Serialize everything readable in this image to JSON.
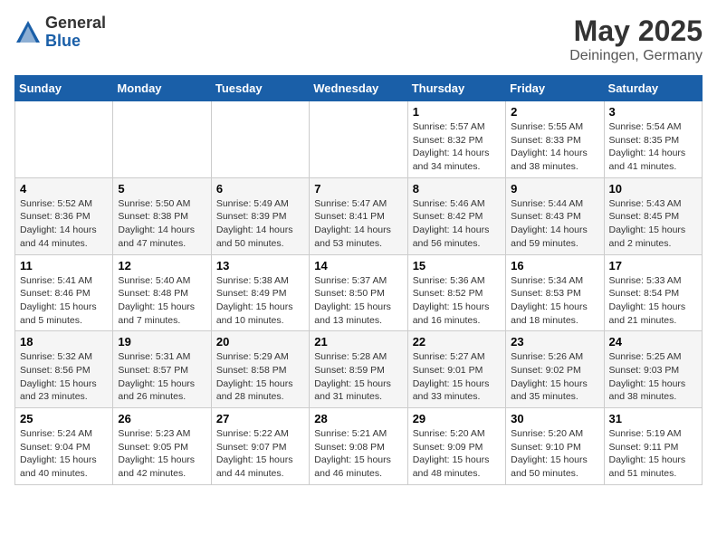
{
  "header": {
    "logo_general": "General",
    "logo_blue": "Blue",
    "month": "May 2025",
    "location": "Deiningen, Germany"
  },
  "days_of_week": [
    "Sunday",
    "Monday",
    "Tuesday",
    "Wednesday",
    "Thursday",
    "Friday",
    "Saturday"
  ],
  "weeks": [
    [
      {
        "day": "",
        "info": ""
      },
      {
        "day": "",
        "info": ""
      },
      {
        "day": "",
        "info": ""
      },
      {
        "day": "",
        "info": ""
      },
      {
        "day": "1",
        "info": "Sunrise: 5:57 AM\nSunset: 8:32 PM\nDaylight: 14 hours\nand 34 minutes."
      },
      {
        "day": "2",
        "info": "Sunrise: 5:55 AM\nSunset: 8:33 PM\nDaylight: 14 hours\nand 38 minutes."
      },
      {
        "day": "3",
        "info": "Sunrise: 5:54 AM\nSunset: 8:35 PM\nDaylight: 14 hours\nand 41 minutes."
      }
    ],
    [
      {
        "day": "4",
        "info": "Sunrise: 5:52 AM\nSunset: 8:36 PM\nDaylight: 14 hours\nand 44 minutes."
      },
      {
        "day": "5",
        "info": "Sunrise: 5:50 AM\nSunset: 8:38 PM\nDaylight: 14 hours\nand 47 minutes."
      },
      {
        "day": "6",
        "info": "Sunrise: 5:49 AM\nSunset: 8:39 PM\nDaylight: 14 hours\nand 50 minutes."
      },
      {
        "day": "7",
        "info": "Sunrise: 5:47 AM\nSunset: 8:41 PM\nDaylight: 14 hours\nand 53 minutes."
      },
      {
        "day": "8",
        "info": "Sunrise: 5:46 AM\nSunset: 8:42 PM\nDaylight: 14 hours\nand 56 minutes."
      },
      {
        "day": "9",
        "info": "Sunrise: 5:44 AM\nSunset: 8:43 PM\nDaylight: 14 hours\nand 59 minutes."
      },
      {
        "day": "10",
        "info": "Sunrise: 5:43 AM\nSunset: 8:45 PM\nDaylight: 15 hours\nand 2 minutes."
      }
    ],
    [
      {
        "day": "11",
        "info": "Sunrise: 5:41 AM\nSunset: 8:46 PM\nDaylight: 15 hours\nand 5 minutes."
      },
      {
        "day": "12",
        "info": "Sunrise: 5:40 AM\nSunset: 8:48 PM\nDaylight: 15 hours\nand 7 minutes."
      },
      {
        "day": "13",
        "info": "Sunrise: 5:38 AM\nSunset: 8:49 PM\nDaylight: 15 hours\nand 10 minutes."
      },
      {
        "day": "14",
        "info": "Sunrise: 5:37 AM\nSunset: 8:50 PM\nDaylight: 15 hours\nand 13 minutes."
      },
      {
        "day": "15",
        "info": "Sunrise: 5:36 AM\nSunset: 8:52 PM\nDaylight: 15 hours\nand 16 minutes."
      },
      {
        "day": "16",
        "info": "Sunrise: 5:34 AM\nSunset: 8:53 PM\nDaylight: 15 hours\nand 18 minutes."
      },
      {
        "day": "17",
        "info": "Sunrise: 5:33 AM\nSunset: 8:54 PM\nDaylight: 15 hours\nand 21 minutes."
      }
    ],
    [
      {
        "day": "18",
        "info": "Sunrise: 5:32 AM\nSunset: 8:56 PM\nDaylight: 15 hours\nand 23 minutes."
      },
      {
        "day": "19",
        "info": "Sunrise: 5:31 AM\nSunset: 8:57 PM\nDaylight: 15 hours\nand 26 minutes."
      },
      {
        "day": "20",
        "info": "Sunrise: 5:29 AM\nSunset: 8:58 PM\nDaylight: 15 hours\nand 28 minutes."
      },
      {
        "day": "21",
        "info": "Sunrise: 5:28 AM\nSunset: 8:59 PM\nDaylight: 15 hours\nand 31 minutes."
      },
      {
        "day": "22",
        "info": "Sunrise: 5:27 AM\nSunset: 9:01 PM\nDaylight: 15 hours\nand 33 minutes."
      },
      {
        "day": "23",
        "info": "Sunrise: 5:26 AM\nSunset: 9:02 PM\nDaylight: 15 hours\nand 35 minutes."
      },
      {
        "day": "24",
        "info": "Sunrise: 5:25 AM\nSunset: 9:03 PM\nDaylight: 15 hours\nand 38 minutes."
      }
    ],
    [
      {
        "day": "25",
        "info": "Sunrise: 5:24 AM\nSunset: 9:04 PM\nDaylight: 15 hours\nand 40 minutes."
      },
      {
        "day": "26",
        "info": "Sunrise: 5:23 AM\nSunset: 9:05 PM\nDaylight: 15 hours\nand 42 minutes."
      },
      {
        "day": "27",
        "info": "Sunrise: 5:22 AM\nSunset: 9:07 PM\nDaylight: 15 hours\nand 44 minutes."
      },
      {
        "day": "28",
        "info": "Sunrise: 5:21 AM\nSunset: 9:08 PM\nDaylight: 15 hours\nand 46 minutes."
      },
      {
        "day": "29",
        "info": "Sunrise: 5:20 AM\nSunset: 9:09 PM\nDaylight: 15 hours\nand 48 minutes."
      },
      {
        "day": "30",
        "info": "Sunrise: 5:20 AM\nSunset: 9:10 PM\nDaylight: 15 hours\nand 50 minutes."
      },
      {
        "day": "31",
        "info": "Sunrise: 5:19 AM\nSunset: 9:11 PM\nDaylight: 15 hours\nand 51 minutes."
      }
    ]
  ]
}
